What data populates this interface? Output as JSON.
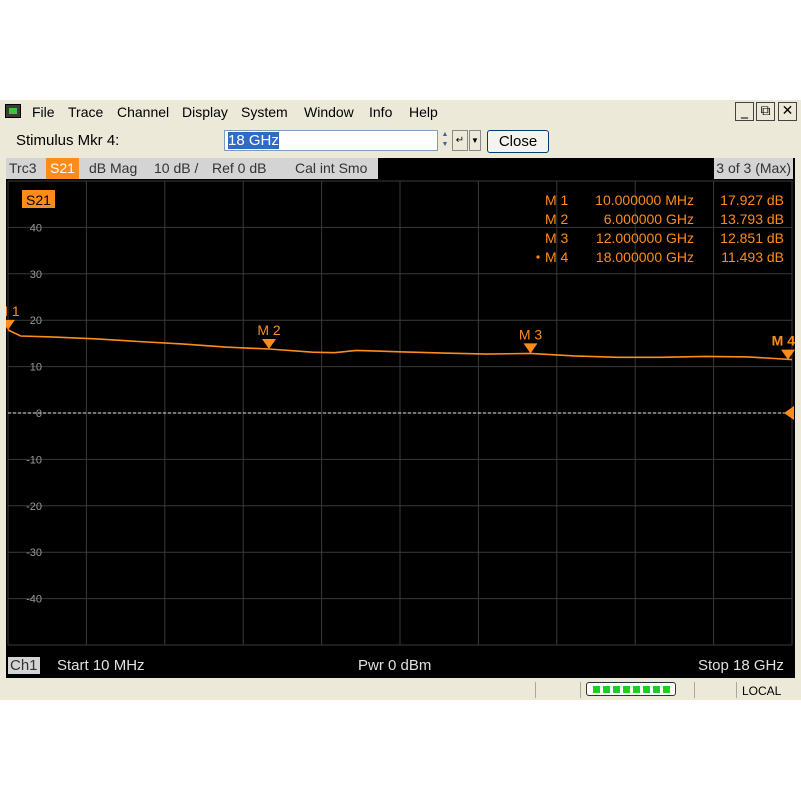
{
  "menu": {
    "items": [
      "File",
      "Trace",
      "Channel",
      "Display",
      "System",
      "Window",
      "Info",
      "Help"
    ],
    "window_controls": [
      "_",
      "⧉",
      "✕"
    ]
  },
  "stimulus": {
    "label": "Stimulus Mkr 4:",
    "value": "18 GHz",
    "close_label": "Close"
  },
  "trace_bar": {
    "trc": "Trc3",
    "param": "S21",
    "format": "dB Mag",
    "scale": "10 dB /",
    "ref": "Ref 0 dB",
    "cal": "Cal int Smo",
    "count": "3 of 3 (Max)"
  },
  "markers": [
    {
      "label": "M 1",
      "freq": "10.000000 MHz",
      "value": "17.927 dB",
      "active": false
    },
    {
      "label": "M 2",
      "freq": "6.000000 GHz",
      "value": "13.793 dB",
      "active": false
    },
    {
      "label": "M 3",
      "freq": "12.000000 GHz",
      "value": "12.851 dB",
      "active": false
    },
    {
      "label": "M 4",
      "freq": "18.000000 GHz",
      "value": "11.493 dB",
      "active": true
    }
  ],
  "status": {
    "channel": "Ch1",
    "start": "Start  10 MHz",
    "power": "Pwr  0 dBm",
    "stop": "Stop  18 GHz"
  },
  "bottom": {
    "remote_state": "LOCAL"
  },
  "colors": {
    "trace": "#ff8c1a",
    "grid": "#3a3a3a",
    "background": "#000000"
  },
  "chart_data": {
    "type": "line",
    "trace_label": "S21",
    "x_unit": "GHz",
    "xlim": [
      0.01,
      18
    ],
    "ylim": [
      -50,
      50
    ],
    "ytick_values": [
      40,
      30,
      20,
      10,
      0,
      -10,
      -20,
      -30,
      -40
    ],
    "yticks": [
      "40",
      "30",
      "20",
      "10",
      "0",
      "-10",
      "-20",
      "-30",
      "-40"
    ],
    "reference_level": 0,
    "x": [
      0.01,
      0.3,
      1.0,
      2.0,
      3.0,
      4.0,
      5.0,
      6.0,
      7.0,
      7.5,
      8.0,
      9.0,
      10.0,
      11.0,
      12.0,
      13.0,
      14.0,
      15.0,
      16.0,
      17.0,
      18.0
    ],
    "y": [
      17.9,
      16.6,
      16.4,
      16.0,
      15.4,
      14.9,
      14.2,
      13.8,
      13.1,
      13.0,
      13.5,
      13.2,
      12.9,
      12.7,
      12.85,
      12.3,
      12.0,
      12.0,
      12.2,
      12.1,
      11.5
    ],
    "marker_points": [
      {
        "x": 0.01,
        "y": 17.927
      },
      {
        "x": 6.0,
        "y": 13.793
      },
      {
        "x": 12.0,
        "y": 12.851
      },
      {
        "x": 18.0,
        "y": 11.493
      }
    ]
  }
}
